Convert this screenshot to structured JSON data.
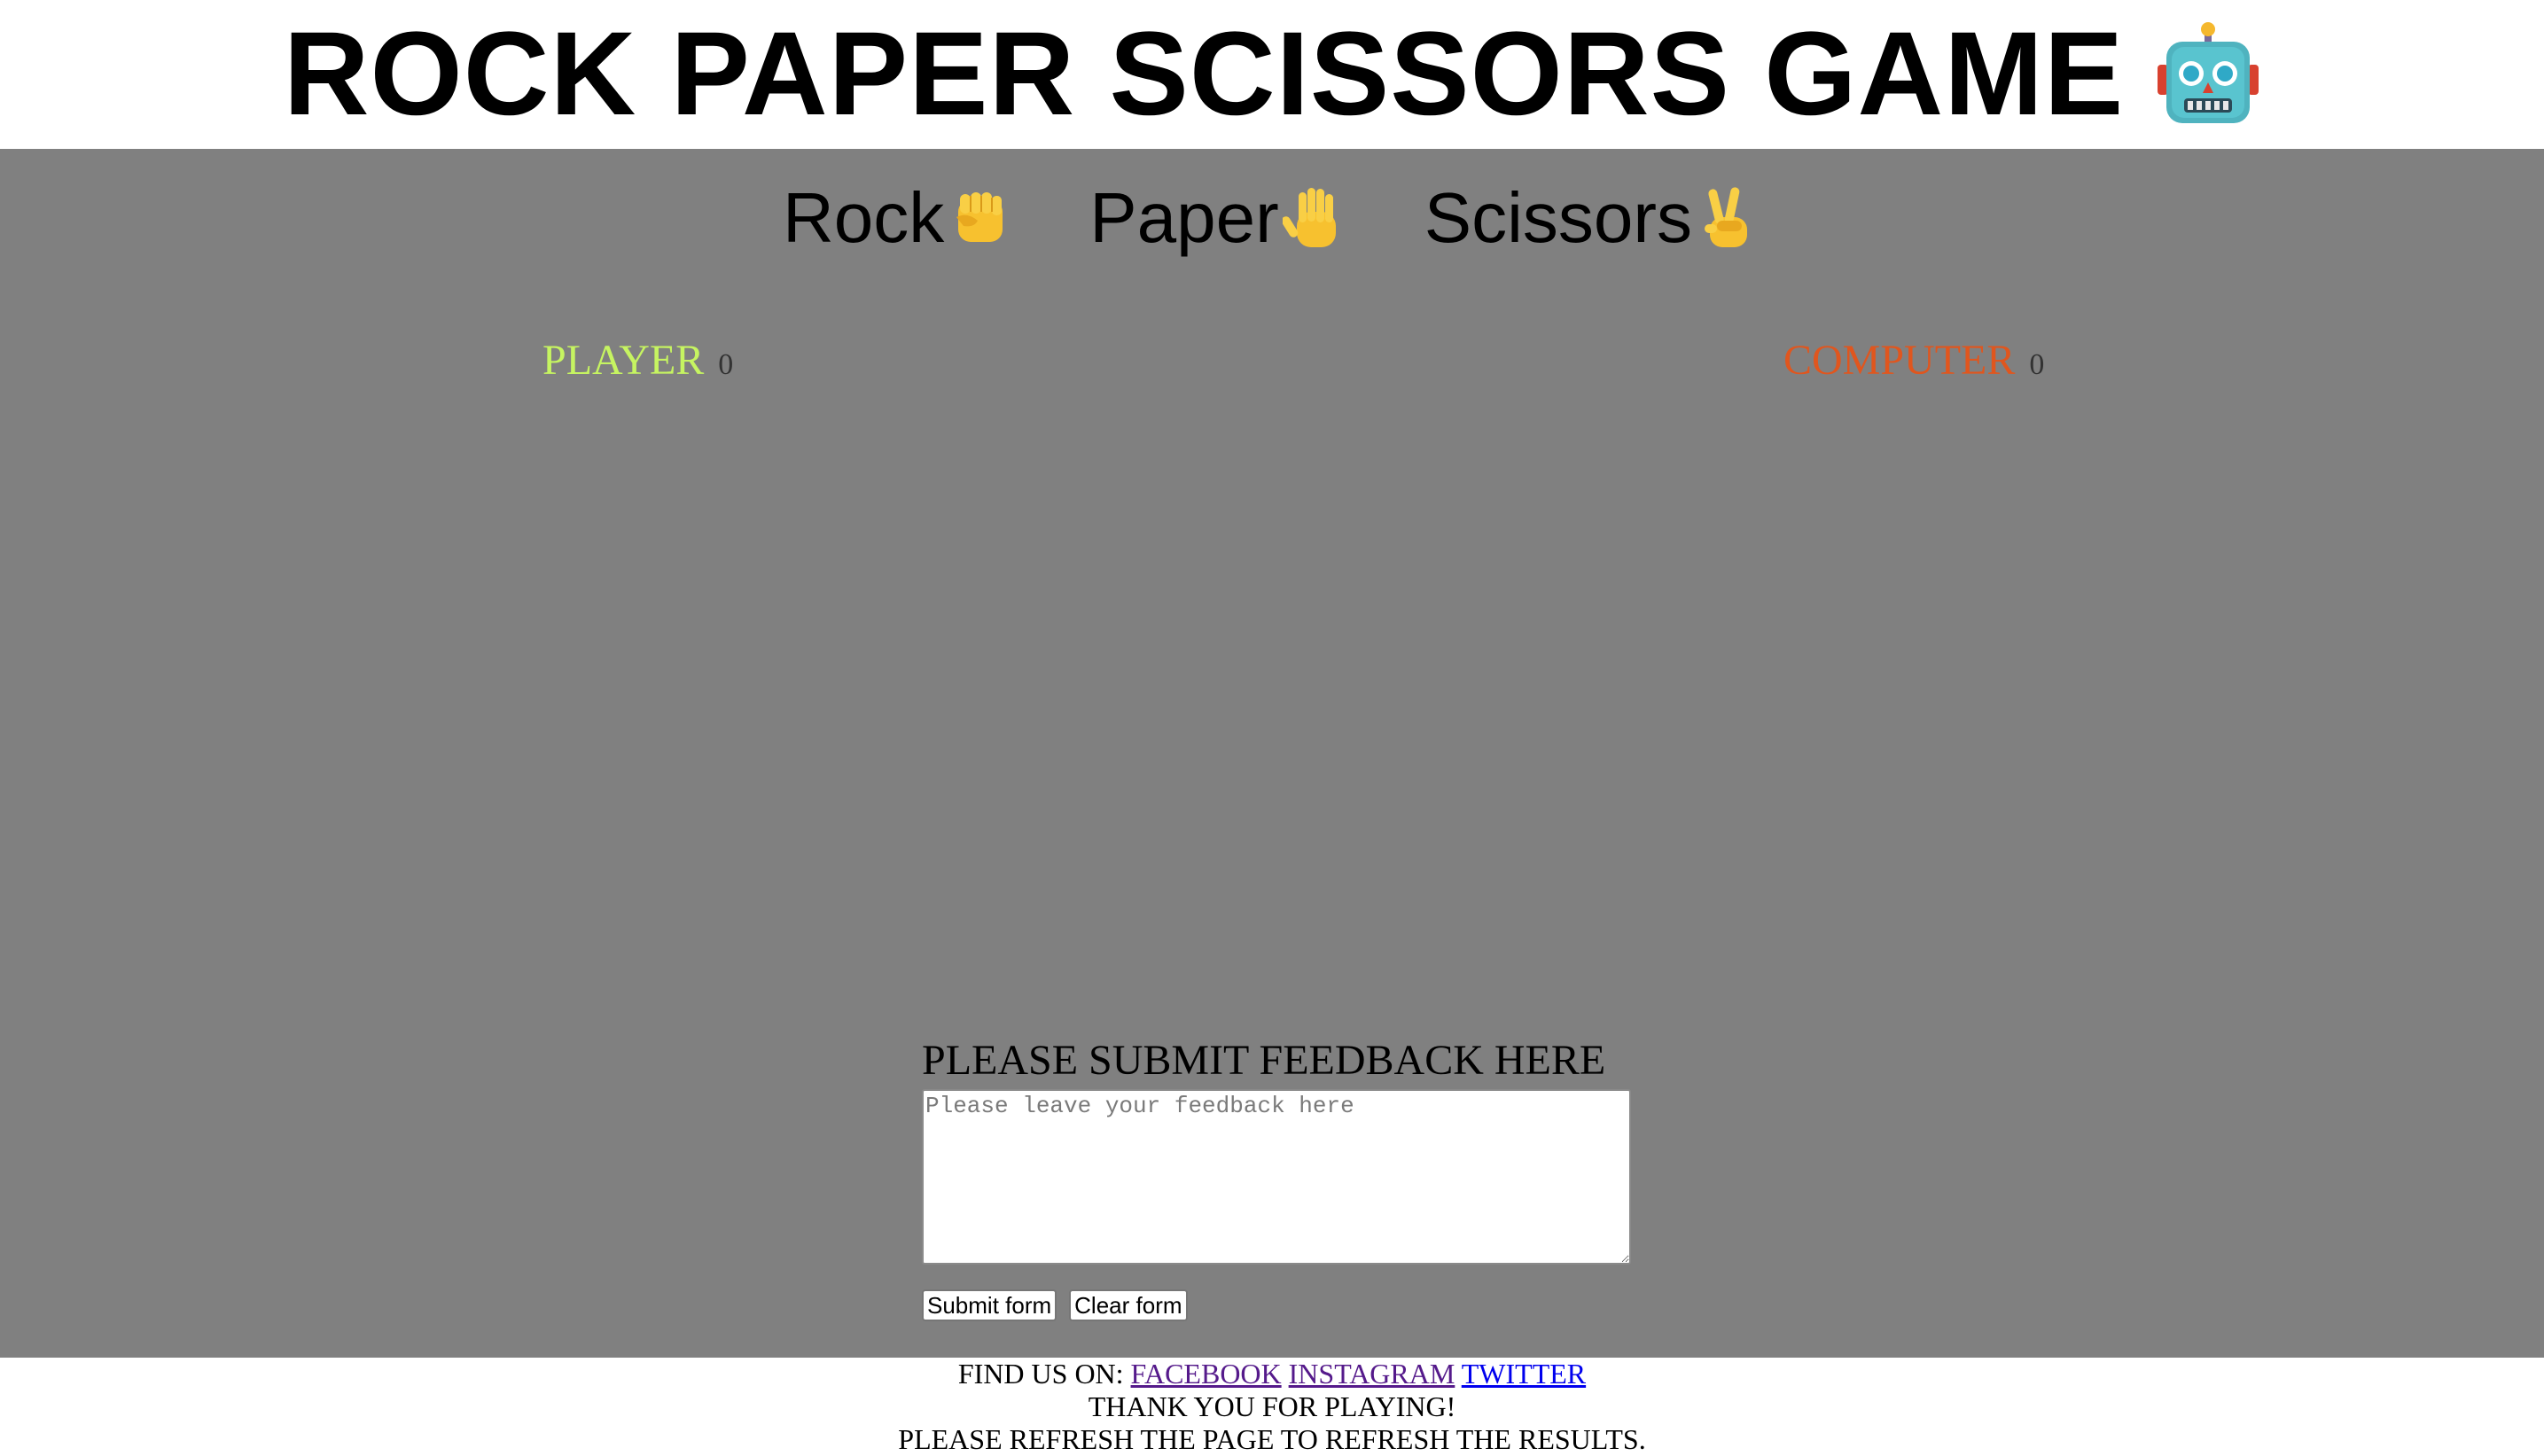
{
  "header": {
    "title": "ROCK PAPER SCISSORS GAME",
    "title_icon": "robot-face-icon"
  },
  "choices": [
    {
      "label": "Rock",
      "icon": "raised-fist-icon"
    },
    {
      "label": "Paper",
      "icon": "raised-hand-icon"
    },
    {
      "label": "Scissors",
      "icon": "victory-hand-icon"
    }
  ],
  "scoreboard": {
    "player_label": "PLAYER",
    "player_score": "0",
    "computer_label": "COMPUTER",
    "computer_score": "0",
    "player_color": "#c6f461",
    "computer_color": "#e0561e"
  },
  "feedback": {
    "heading": "PLEASE SUBMIT FEEDBACK HERE",
    "placeholder": "Please leave your feedback here",
    "value": "",
    "submit_label": "Submit form",
    "clear_label": "Clear form"
  },
  "footer": {
    "find_us_label": "FIND US ON:",
    "links": [
      "FACEBOOK",
      "INSTAGRAM",
      "TWITTER"
    ],
    "thank_you": "THANK YOU FOR PLAYING!",
    "refresh_note": "PLEASE REFRESH THE PAGE TO REFRESH THE RESULTS."
  },
  "colors": {
    "main_background": "#808080",
    "page_background": "#ffffff"
  }
}
